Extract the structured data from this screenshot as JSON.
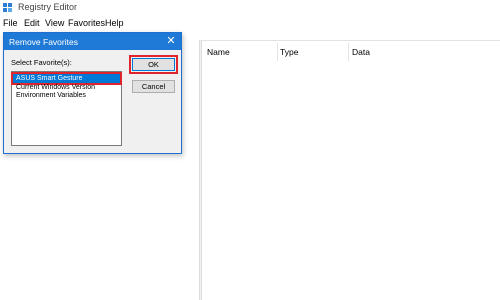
{
  "window": {
    "title": "Registry Editor",
    "icon": "registry-editor-icon"
  },
  "menu": {
    "items": [
      "File",
      "Edit",
      "View",
      "Favorites",
      "Help"
    ]
  },
  "right_pane": {
    "columns": [
      "Name",
      "Type",
      "Data"
    ]
  },
  "dialog": {
    "title": "Remove Favorites",
    "close_symbol": "✕",
    "select_label": "Select Favorite(s):",
    "favorites": [
      "ASUS Smart Gesture",
      "Current Windows Version",
      "Environment Variables"
    ],
    "selected_index": 0,
    "ok_label": "OK",
    "cancel_label": "Cancel"
  },
  "colors": {
    "dialog_title_bg": "#1e7ad6",
    "selection_bg": "#0078d7",
    "highlight_outline": "#e0242c"
  }
}
